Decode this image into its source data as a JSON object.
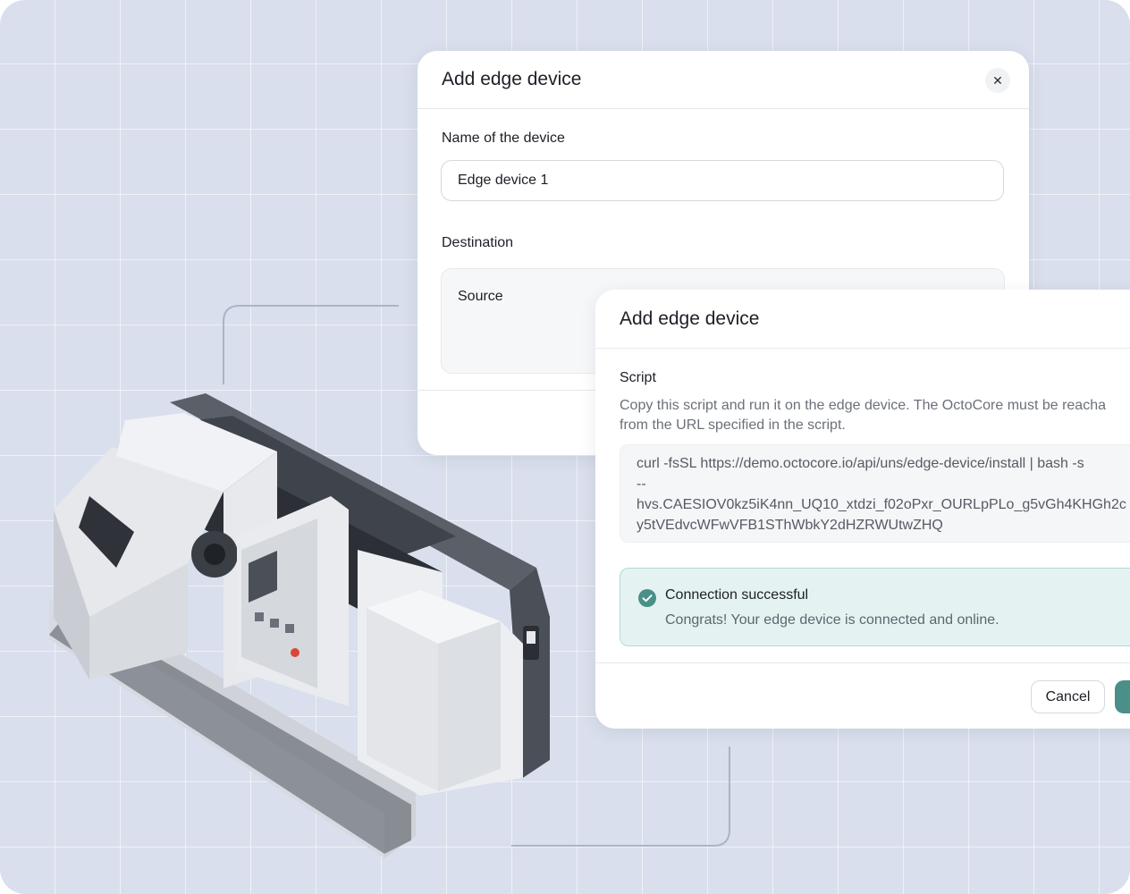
{
  "dialog_back": {
    "title": "Add edge device",
    "close_symbol": "✕",
    "name_label": "Name of the device",
    "name_value": "Edge device 1",
    "destination_label": "Destination",
    "source_label": "Source"
  },
  "dialog_front": {
    "title": "Add edge device",
    "script_label": "Script",
    "description_lines": [
      "Copy this script and run it on the edge device. The OctoCore must be reacha",
      "from the URL specified in the script."
    ],
    "script_lines": [
      "curl -fsSL https://demo.octocore.io/api/uns/edge-device/install | bash -s",
      "--",
      "hvs.CAESIOV0kz5iK4nn_UQ10_xtdzi_f02oPxr_OURLpPLo_g5vGh4KHGh2c",
      "y5tVEdvcWFwVFB1SThWbkY2dHZRWUtwZHQ"
    ],
    "success": {
      "title": "Connection successful",
      "message": "Congrats! Your edge device is connected and online."
    },
    "cancel_label": "Cancel"
  },
  "colors": {
    "background": "#d9dfec",
    "accent": "#4a8f88",
    "success_bg": "#e4f3f2",
    "success_border": "#b3d9d6"
  },
  "icons": {
    "close": "close-icon",
    "success": "check-circle-icon"
  }
}
